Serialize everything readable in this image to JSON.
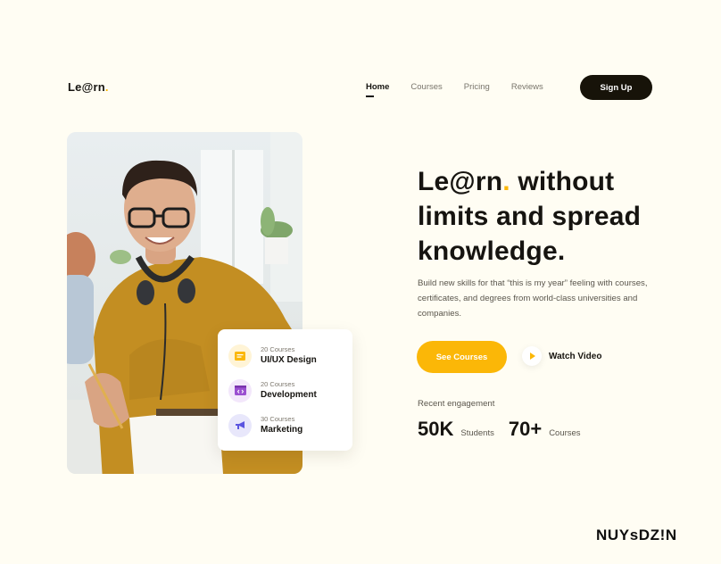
{
  "brand": {
    "logo_main": "Le@rn",
    "logo_dot": "."
  },
  "nav": {
    "items": [
      {
        "label": "Home",
        "active": true
      },
      {
        "label": "Courses",
        "active": false
      },
      {
        "label": "Pricing",
        "active": false
      },
      {
        "label": "Reviews",
        "active": false
      }
    ],
    "signup_label": "Sign Up"
  },
  "courses": [
    {
      "count": "20 Courses",
      "name": "UI/UX Design",
      "icon": "document-icon",
      "color": "#fbb707",
      "bg": "#fff4d6"
    },
    {
      "count": "20 Courses",
      "name": "Development",
      "icon": "code-window-icon",
      "color": "#9b4fd1",
      "bg": "#f3e7fb"
    },
    {
      "count": "30 Courses",
      "name": "Marketing",
      "icon": "megaphone-icon",
      "color": "#5b55e0",
      "bg": "#e8e7fb"
    }
  ],
  "hero": {
    "title_brand": "Le@rn",
    "title_dot": ".",
    "title_rest": " without limits and spread knowledge.",
    "description": "Build new skills for that “this is my year” feeling with courses, certificates, and degrees from world-class universities and companies.",
    "cta_primary": "See Courses",
    "cta_secondary": "Watch Video"
  },
  "engagement": {
    "label": "Recent engagement",
    "stats": [
      {
        "value": "50K",
        "unit": "Students"
      },
      {
        "value": "70+",
        "unit": "Courses"
      }
    ]
  },
  "watermark": "NUYsDZ!N",
  "colors": {
    "accent": "#fbb707",
    "dark": "#171309",
    "background": "#fffdf3"
  }
}
